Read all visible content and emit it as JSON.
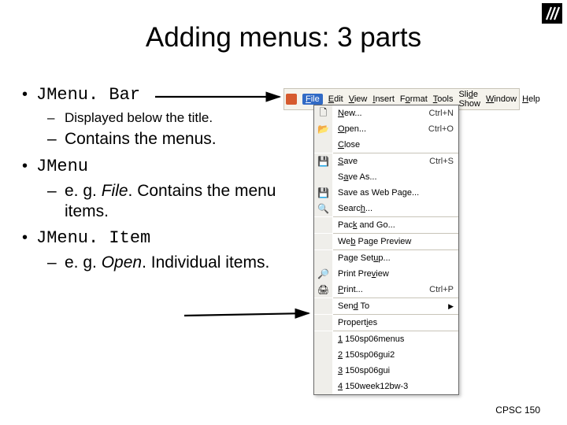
{
  "title": "Adding menus: 3 parts",
  "footer": "CPSC 150",
  "bullets": {
    "b1": {
      "text": "JMenu. Bar"
    },
    "b1a": {
      "text": "Displayed below the title."
    },
    "b1b": {
      "text": "Contains the menus."
    },
    "b2": {
      "text": "JMenu"
    },
    "b2a_pre": "e. g. ",
    "b2a_em": "File",
    "b2a_post": ". Contains the menu items.",
    "b3": {
      "text": "JMenu. Item"
    },
    "b3a_pre": "e. g. ",
    "b3a_em": "Open",
    "b3a_post": ". Individual items."
  },
  "menubar": {
    "items": [
      "File",
      "Edit",
      "View",
      "Insert",
      "Format",
      "Tools",
      "Slide Show",
      "Window",
      "Help"
    ]
  },
  "dropdown": {
    "rows": [
      {
        "icon": "new-icon",
        "label": "New...",
        "shortcut": "Ctrl+N"
      },
      {
        "icon": "open-icon",
        "label": "Open...",
        "shortcut": "Ctrl+O"
      },
      {
        "icon": "",
        "label": "Close",
        "shortcut": ""
      },
      {
        "sep": true
      },
      {
        "icon": "save-icon",
        "label": "Save",
        "shortcut": "Ctrl+S"
      },
      {
        "icon": "",
        "label": "Save As...",
        "shortcut": ""
      },
      {
        "icon": "saveweb-icon",
        "label": "Save as Web Page...",
        "shortcut": ""
      },
      {
        "icon": "search-icon",
        "label": "Search...",
        "shortcut": ""
      },
      {
        "sep": true
      },
      {
        "icon": "",
        "label": "Pack and Go...",
        "shortcut": ""
      },
      {
        "sep": true
      },
      {
        "icon": "",
        "label": "Web Page Preview",
        "shortcut": ""
      },
      {
        "sep": true
      },
      {
        "icon": "",
        "label": "Page Setup...",
        "shortcut": ""
      },
      {
        "icon": "preview-icon",
        "label": "Print Preview",
        "shortcut": ""
      },
      {
        "icon": "print-icon",
        "label": "Print...",
        "shortcut": "Ctrl+P"
      },
      {
        "sep": true
      },
      {
        "icon": "",
        "label": "Send To",
        "submenu": true
      },
      {
        "sep": true
      },
      {
        "icon": "",
        "label": "Properties",
        "shortcut": ""
      },
      {
        "sep": true
      },
      {
        "icon": "",
        "label": "1 150sp06menus",
        "shortcut": ""
      },
      {
        "icon": "",
        "label": "2 150sp06gui2",
        "shortcut": ""
      },
      {
        "icon": "",
        "label": "3 150sp06gui",
        "shortcut": ""
      },
      {
        "icon": "",
        "label": "4 150week12bw-3",
        "shortcut": ""
      }
    ]
  },
  "menubar_underline_map": {
    "File": "F",
    "Edit": "E",
    "View": "V",
    "Insert": "I",
    "Format": "o",
    "Tools": "T",
    "Slide Show": "D",
    "Window": "W",
    "Help": "H"
  },
  "dd_underline_map": {
    "New...": "N",
    "Open...": "O",
    "Close": "C",
    "Save": "S",
    "Save As...": "A",
    "Save as Web Page...": "G",
    "Search...": "h",
    "Pack and Go...": "k",
    "Web Page Preview": "b",
    "Page Setup...": "u",
    "Print Preview": "v",
    "Print...": "P",
    "Send To": "d",
    "Properties": "i",
    "1 150sp06menus": "1",
    "2 150sp06gui2": "2",
    "3 150sp06gui": "3",
    "4 150week12bw-3": "4"
  },
  "icon_glyphs": {
    "new-icon": "🗋",
    "open-icon": "📂",
    "save-icon": "💾",
    "saveweb-icon": "💾",
    "search-icon": "🔍",
    "preview-icon": "🔎",
    "print-icon": "🖨"
  }
}
